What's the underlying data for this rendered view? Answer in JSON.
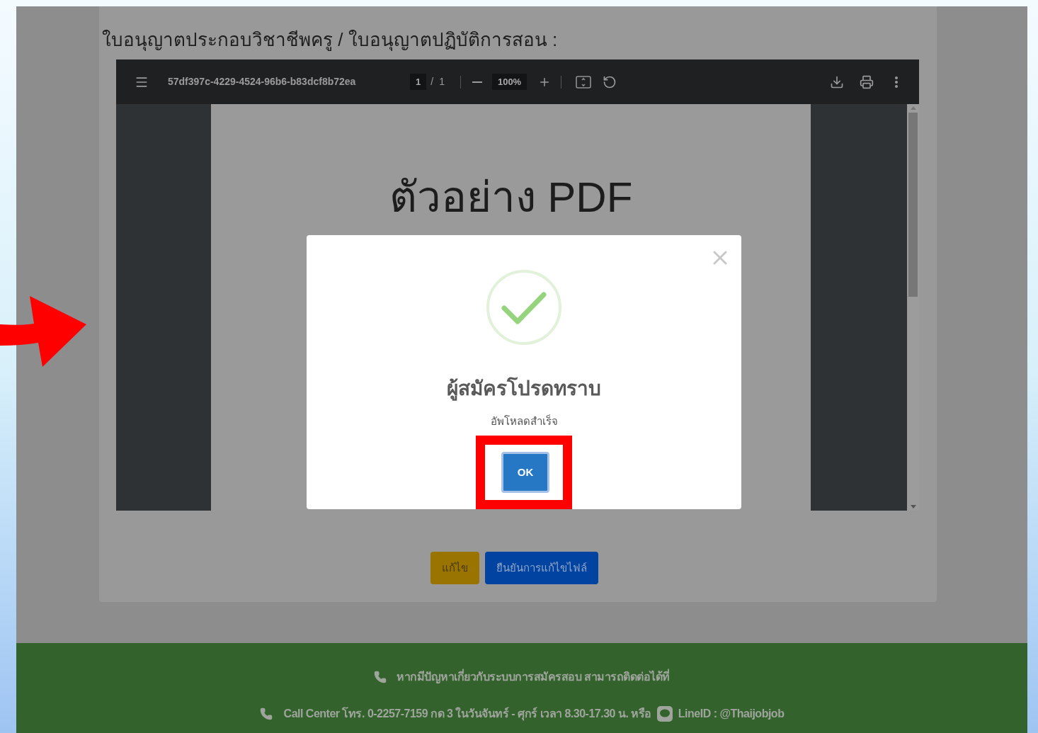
{
  "form": {
    "field_label": "ใบอนุญาตประกอบวิชาชีพครู / ใบอนุญาตปฏิบัติการสอน :",
    "pdf_viewer": {
      "file_name": "57df397c-4229-4524-96b6-b83dcf8b72ea",
      "page_current": "1",
      "page_separator": "/",
      "page_total": "1",
      "zoom": "100%",
      "document_title": "ตัวอย่าง PDF"
    },
    "buttons": [
      {
        "label": "แก้ไข",
        "kind": "edit"
      },
      {
        "label": "ยืนยันการแก้ไขไฟล์",
        "kind": "confirm"
      }
    ]
  },
  "dialog": {
    "kind": "success",
    "title": "ผู้สมัครโปรดทราบ",
    "message": "อัพโหลดสำเร็จ",
    "button": "OK"
  },
  "footer": {
    "help_text": "หากมีปัญหาเกี่ยวกับระบบการสมัครสอบ สามารถติดต่อได้ที่",
    "contact_text": "Call Center โทร. 0-2257-7159 กด 3 ในวันจันทร์ - ศุกร์ เวลา 8.30-17.30 น. หรือ",
    "line_id": "LineID : @Thaijobjob"
  }
}
